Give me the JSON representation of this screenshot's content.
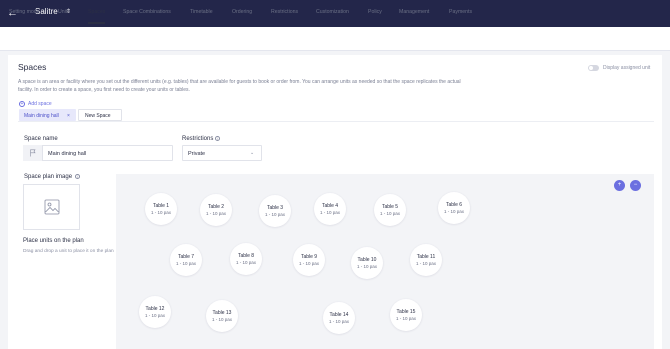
{
  "topbar": {
    "back_icon": "arrow-left-icon",
    "venue_name": "Salitre",
    "venue_caret": "⇕"
  },
  "tabs": [
    "Setting mode",
    "Units",
    "Spaces",
    "Space Combinations",
    "Timetable",
    "Ordering",
    "Restrictions",
    "Customization",
    "Policy",
    "Management",
    "Payments"
  ],
  "active_tab": "Spaces",
  "header": {
    "title": "Spaces",
    "toggle_label": "Display assigned unit",
    "description": "A space is an area or facility where you set out the different units (e.g. tables) that are available for guests to book or order from. You can arrange units as needed so that the space replicates the actual facility. In order to create a space, you first need to create your units or tables."
  },
  "add_space_label": "Add space",
  "space_tabs": [
    {
      "label": "Main dining hall",
      "closable": true,
      "active": true
    },
    {
      "label": "New Space",
      "closable": false,
      "active": false
    }
  ],
  "form": {
    "space_name_label": "Space name",
    "space_name_value": "Main dining hall",
    "restrictions_label": "Restrictions",
    "restrictions_value": "Private",
    "plan_image_label": "Space plan image",
    "place_units_title": "Place units on the plan",
    "place_units_hint": "Drag and drop a unit to place it on the plan"
  },
  "zoom": {
    "in_icon": "zoom-in-icon",
    "out_icon": "zoom-out-icon",
    "in_symbol": "+",
    "out_symbol": "−"
  },
  "tables": [
    {
      "name": "Table 1",
      "pax": "1 - 10 pax"
    },
    {
      "name": "Table 2",
      "pax": "1 - 10 pax"
    },
    {
      "name": "Table 3",
      "pax": "1 - 10 pax"
    },
    {
      "name": "Table 4",
      "pax": "1 - 10 pax"
    },
    {
      "name": "Table 5",
      "pax": "1 - 10 pax"
    },
    {
      "name": "Table 6",
      "pax": "1 - 10 pax"
    },
    {
      "name": "Table 7",
      "pax": "1 - 10 pax"
    },
    {
      "name": "Table 8",
      "pax": "1 - 10 pax"
    },
    {
      "name": "Table 9",
      "pax": "1 - 10 pax"
    },
    {
      "name": "Table 10",
      "pax": "1 - 10 pax"
    },
    {
      "name": "Table 11",
      "pax": "1 - 10 pax"
    },
    {
      "name": "Table 12",
      "pax": "1 - 10 pax"
    },
    {
      "name": "Table 13",
      "pax": "1 - 10 pax"
    },
    {
      "name": "Table 14",
      "pax": "1 - 10 pax"
    },
    {
      "name": "Table 15",
      "pax": "1 - 10 pax"
    }
  ],
  "colors": {
    "topbar": "#23264a",
    "accent": "#6b6fe0",
    "background": "#f3f4f7"
  }
}
